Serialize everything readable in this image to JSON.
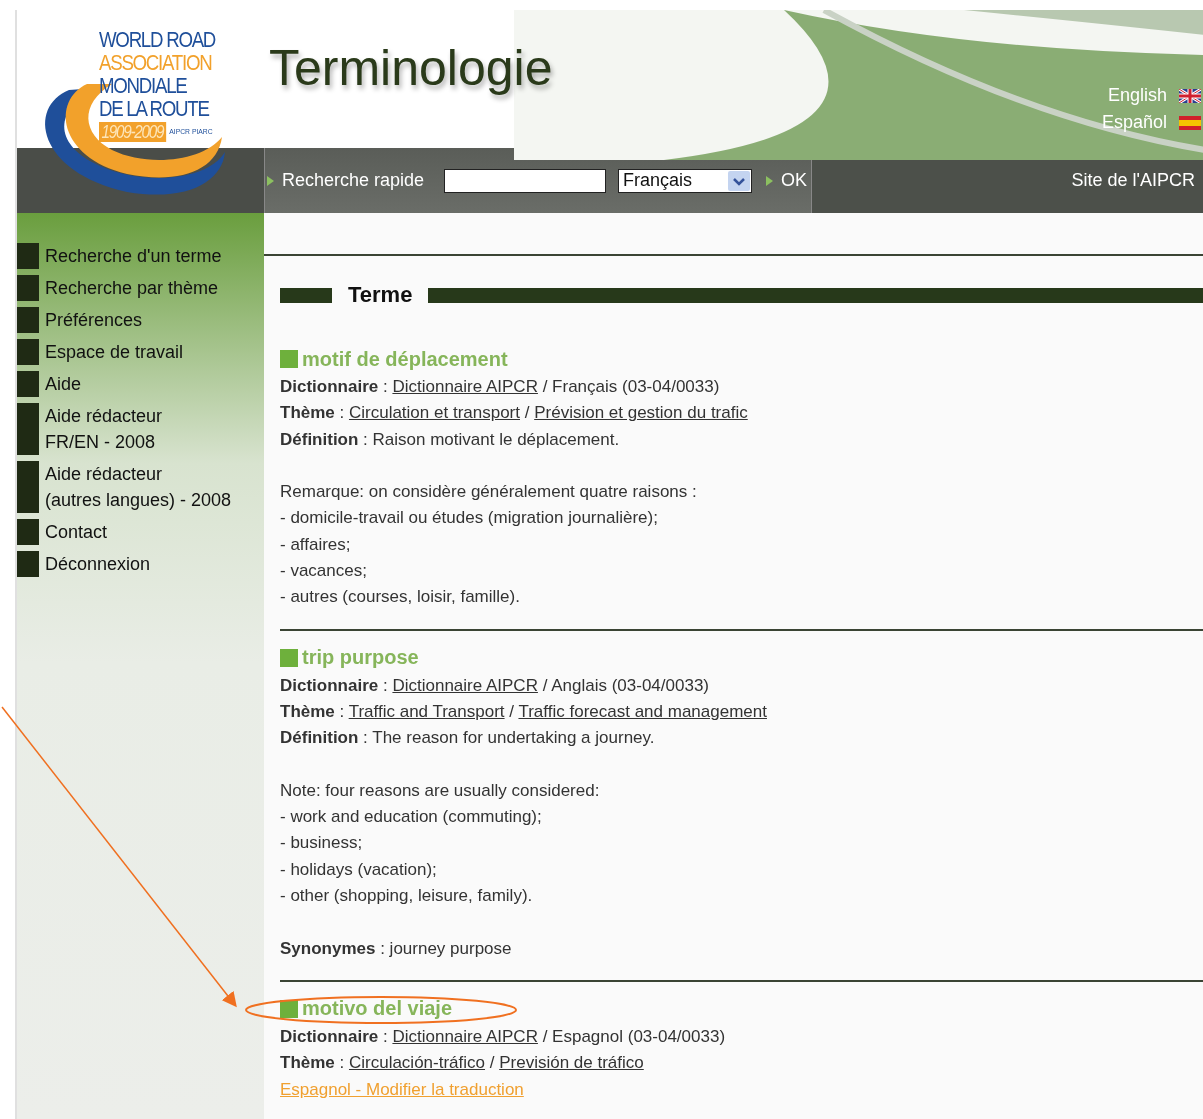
{
  "logo": {
    "lines": [
      {
        "text": "WORLD ROAD",
        "kind": "blue"
      },
      {
        "text": "ASSOCIATION",
        "kind": "orange"
      },
      {
        "text": "MONDIALE",
        "kind": "blue"
      },
      {
        "text": "DE LA ROUTE",
        "kind": "blue"
      }
    ],
    "years": "1909-2009",
    "tag": "AIPCR PIARC"
  },
  "header": {
    "title": "Terminologie",
    "languages": [
      {
        "label": "English",
        "kind": "uk"
      },
      {
        "label": "Español",
        "kind": "es"
      }
    ]
  },
  "search": {
    "label": "Recherche rapide",
    "language": "Français",
    "submit": "OK",
    "site_link": "Site de l'AIPCR"
  },
  "sidebar": {
    "items": [
      {
        "lines": [
          "Recherche d'un terme"
        ]
      },
      {
        "lines": [
          "Recherche par thème"
        ]
      },
      {
        "lines": [
          "Préférences"
        ]
      },
      {
        "lines": [
          "Espace de travail"
        ]
      },
      {
        "lines": [
          "Aide"
        ]
      },
      {
        "lines": [
          "Aide rédacteur",
          "FR/EN - 2008"
        ]
      },
      {
        "lines": [
          "Aide rédacteur",
          "(autres langues) - 2008"
        ]
      },
      {
        "lines": [
          "Contact"
        ]
      },
      {
        "lines": [
          "Déconnexion"
        ]
      }
    ]
  },
  "section_title": "Terme",
  "terms": [
    {
      "title": "motif de déplacement",
      "lines": [
        {
          "kind": "field",
          "parts": [
            {
              "kind": "label",
              "text": "Dictionnaire"
            },
            {
              "kind": "plain",
              "text": " : "
            },
            {
              "kind": "link",
              "text": "Dictionnaire AIPCR"
            },
            {
              "kind": "plain",
              "text": " / Français (03-04/0033)"
            }
          ]
        },
        {
          "kind": "field",
          "parts": [
            {
              "kind": "label",
              "text": "Thème"
            },
            {
              "kind": "plain",
              "text": " : "
            },
            {
              "kind": "link",
              "text": "Circulation et transport"
            },
            {
              "kind": "plain",
              "text": " / "
            },
            {
              "kind": "link",
              "text": "Prévision et gestion du trafic"
            }
          ]
        },
        {
          "kind": "field",
          "parts": [
            {
              "kind": "label",
              "text": "Définition"
            },
            {
              "kind": "plain",
              "text": " : Raison motivant le déplacement."
            }
          ]
        },
        {
          "kind": "blank"
        },
        {
          "kind": "text",
          "text": "Remarque: on considère généralement quatre raisons :"
        },
        {
          "kind": "text",
          "text": "- domicile-travail ou études (migration journalière);"
        },
        {
          "kind": "text",
          "text": "- affaires;"
        },
        {
          "kind": "text",
          "text": "- vacances;"
        },
        {
          "kind": "text",
          "text": "- autres (courses, loisir, famille)."
        }
      ]
    },
    {
      "title": "trip purpose",
      "lines": [
        {
          "kind": "field",
          "parts": [
            {
              "kind": "label",
              "text": "Dictionnaire"
            },
            {
              "kind": "plain",
              "text": " : "
            },
            {
              "kind": "link",
              "text": "Dictionnaire AIPCR"
            },
            {
              "kind": "plain",
              "text": " / Anglais (03-04/0033)"
            }
          ]
        },
        {
          "kind": "field",
          "parts": [
            {
              "kind": "label",
              "text": "Thème"
            },
            {
              "kind": "plain",
              "text": " : "
            },
            {
              "kind": "link",
              "text": "Traffic and Transport"
            },
            {
              "kind": "plain",
              "text": " / "
            },
            {
              "kind": "link",
              "text": "Traffic forecast and management"
            }
          ]
        },
        {
          "kind": "field",
          "parts": [
            {
              "kind": "label",
              "text": "Définition"
            },
            {
              "kind": "plain",
              "text": " : The reason for undertaking a journey."
            }
          ]
        },
        {
          "kind": "blank"
        },
        {
          "kind": "text",
          "text": "Note: four reasons are usually considered:"
        },
        {
          "kind": "text",
          "text": "- work and education (commuting);"
        },
        {
          "kind": "text",
          "text": "- business;"
        },
        {
          "kind": "text",
          "text": "- holidays (vacation);"
        },
        {
          "kind": "text",
          "text": "- other (shopping, leisure, family)."
        },
        {
          "kind": "blank"
        },
        {
          "kind": "field",
          "parts": [
            {
              "kind": "label",
              "text": "Synonymes"
            },
            {
              "kind": "plain",
              "text": " : journey purpose"
            }
          ]
        }
      ]
    },
    {
      "title": "motivo del viaje",
      "highlighted": true,
      "lines": [
        {
          "kind": "field",
          "parts": [
            {
              "kind": "label",
              "text": "Dictionnaire"
            },
            {
              "kind": "plain",
              "text": " : "
            },
            {
              "kind": "link",
              "text": "Dictionnaire AIPCR"
            },
            {
              "kind": "plain",
              "text": " / Espagnol (03-04/0033)"
            }
          ]
        },
        {
          "kind": "field",
          "parts": [
            {
              "kind": "label",
              "text": "Thème"
            },
            {
              "kind": "plain",
              "text": " : "
            },
            {
              "kind": "link",
              "text": "Circulación-tráfico"
            },
            {
              "kind": "plain",
              "text": " / "
            },
            {
              "kind": "link",
              "text": "Previsión de tráfico"
            }
          ]
        },
        {
          "kind": "edit_link",
          "text": "Espagnol - Modifier la traduction"
        }
      ]
    }
  ]
}
